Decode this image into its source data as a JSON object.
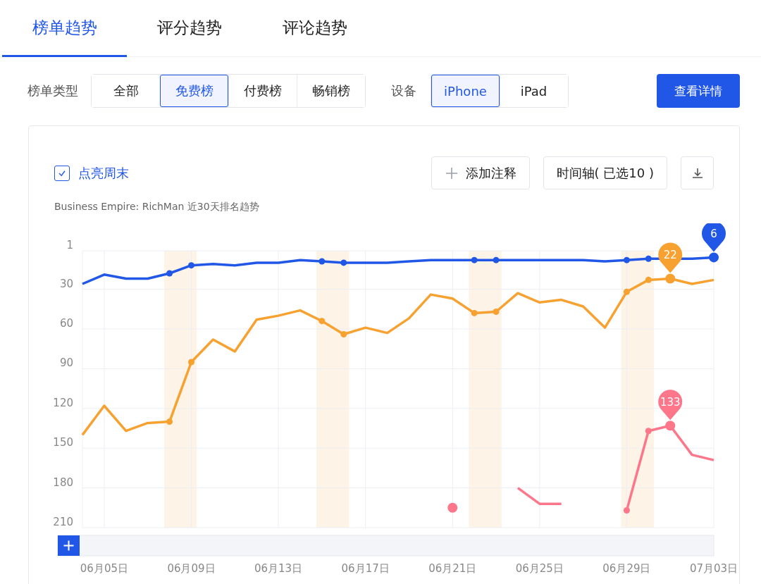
{
  "tabs": [
    {
      "label": "榜单趋势",
      "selected": true
    },
    {
      "label": "评分趋势",
      "selected": false
    },
    {
      "label": "评论趋势",
      "selected": false
    }
  ],
  "filters": {
    "chart_type_label": "榜单类型",
    "chart_types": [
      {
        "label": "全部",
        "selected": false
      },
      {
        "label": "免费榜",
        "selected": true
      },
      {
        "label": "付费榜",
        "selected": false
      },
      {
        "label": "畅销榜",
        "selected": false
      }
    ],
    "device_label": "设备",
    "devices": [
      {
        "label": "iPhone",
        "selected": true
      },
      {
        "label": "iPad",
        "selected": false
      }
    ],
    "details_button": "查看详情"
  },
  "chart_card": {
    "highlight_weekends": {
      "label": "点亮周末",
      "checked": true
    },
    "add_note_button": "添加注释",
    "timeline_button": "时间轴( 已选10 )",
    "subtitle": "Business Empire: RichMan 近30天排名趋势",
    "chart_data": {
      "type": "line",
      "categories": [
        null,
        "06月05日",
        null,
        null,
        null,
        "06月09日",
        null,
        null,
        null,
        "06月13日",
        null,
        null,
        null,
        "06月17日",
        null,
        null,
        null,
        "06月21日",
        null,
        null,
        null,
        "06月25日",
        null,
        null,
        null,
        "06月29日",
        null,
        null,
        null,
        "07月03日"
      ],
      "ylim": [
        210,
        1
      ],
      "yticks": [
        1,
        30,
        60,
        90,
        120,
        150,
        180,
        210
      ],
      "series": [
        {
          "color": "#2157e6",
          "values": [
            26,
            19,
            22,
            22,
            18,
            12,
            11,
            12,
            10,
            10,
            8,
            9,
            10,
            10,
            10,
            9,
            8,
            8,
            8,
            8,
            8,
            8,
            8,
            8,
            9,
            8,
            7,
            7,
            7,
            6
          ]
        },
        {
          "color": "#f7a131",
          "values": [
            140,
            118,
            137,
            131,
            130,
            85,
            68,
            77,
            53,
            50,
            46,
            54,
            64,
            59,
            63,
            52,
            34,
            37,
            48,
            47,
            33,
            40,
            38,
            43,
            59,
            32,
            23,
            22,
            26,
            23
          ]
        },
        {
          "color": "#fd7689",
          "values": [
            null,
            null,
            null,
            null,
            null,
            null,
            null,
            null,
            null,
            null,
            null,
            null,
            null,
            null,
            null,
            null,
            null,
            195,
            null,
            null,
            180,
            192,
            192,
            null,
            null,
            197,
            137,
            133,
            155,
            159
          ]
        }
      ],
      "grid": true,
      "annotations": [
        {
          "y": 22,
          "text": "22"
        },
        {
          "y": 133,
          "text": "133"
        },
        {
          "y": 6,
          "text": "6"
        }
      ]
    }
  }
}
